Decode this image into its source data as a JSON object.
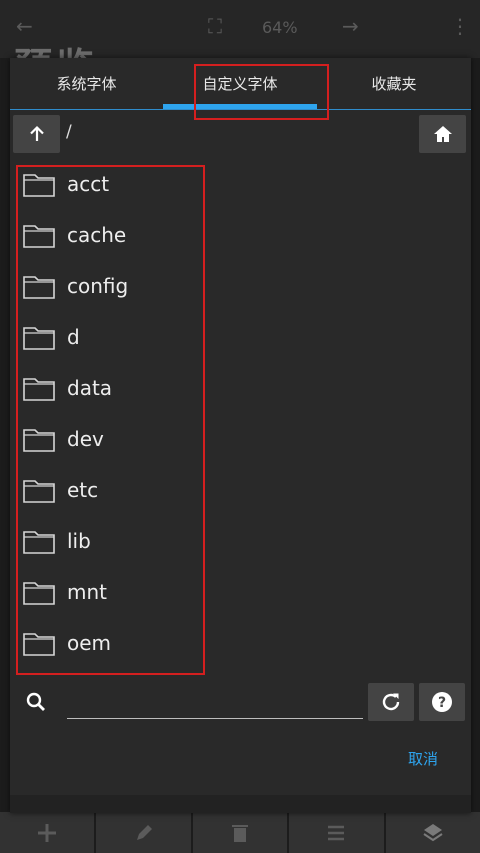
{
  "background": {
    "title": "预览",
    "zoom": "64%"
  },
  "tabs": [
    {
      "label": "系统字体"
    },
    {
      "label": "自定义字体"
    },
    {
      "label": "收藏夹"
    }
  ],
  "nav": {
    "path": "/"
  },
  "folders": [
    "acct",
    "cache",
    "config",
    "d",
    "data",
    "dev",
    "etc",
    "lib",
    "mnt",
    "oem"
  ],
  "search": {
    "value": "",
    "placeholder": ""
  },
  "actions": {
    "cancel_label": "取消"
  },
  "colors": {
    "accent": "#2ea4ee",
    "dialog_bg": "#292929",
    "highlight": "#d41f1f"
  }
}
